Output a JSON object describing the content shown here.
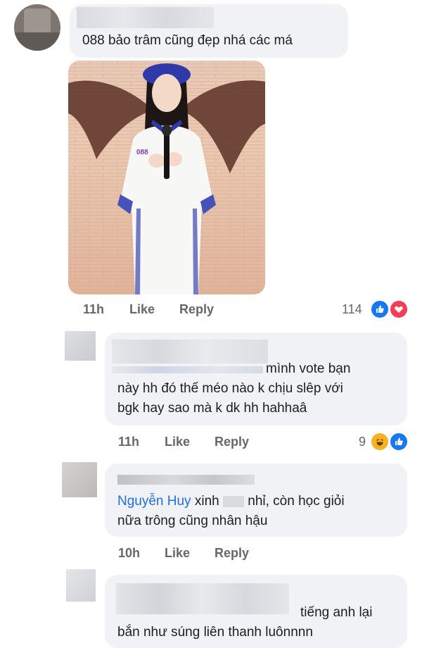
{
  "comments": [
    {
      "text": "088 bảo trâm cũng đẹp nhá các má",
      "time": "11h",
      "like_label": "Like",
      "reply_label": "Reply",
      "reaction_count": "114",
      "reactions": [
        "like-icon",
        "love-icon"
      ],
      "photo_badge": "088"
    },
    {
      "line1": "mình vote bạn",
      "line2": "này hh đó thế méo nào k chịu slêp với",
      "line3": "bgk hay sao mà k dk hh hahhaâ",
      "time": "11h",
      "like_label": "Like",
      "reply_label": "Reply",
      "reaction_count": "9",
      "reactions": [
        "haha-icon",
        "like-icon"
      ]
    },
    {
      "mention": "Nguyễn Huy",
      "line1_rest": "xinh",
      "line1_end": "nhỉ, còn học giỏi",
      "line2": "nữa trông cũng nhân hậu",
      "time": "10h",
      "like_label": "Like",
      "reply_label": "Reply"
    },
    {
      "line1": "tiếng anh lại",
      "line2": "bắn như súng liên thanh luônnnn"
    }
  ],
  "colors": {
    "bubble": "#f0f2f5",
    "meta": "#65676b",
    "mention": "#216fdb",
    "like_blue": "#1877f2",
    "love_red": "#f33e58",
    "haha_yellow": "#f7b125"
  }
}
